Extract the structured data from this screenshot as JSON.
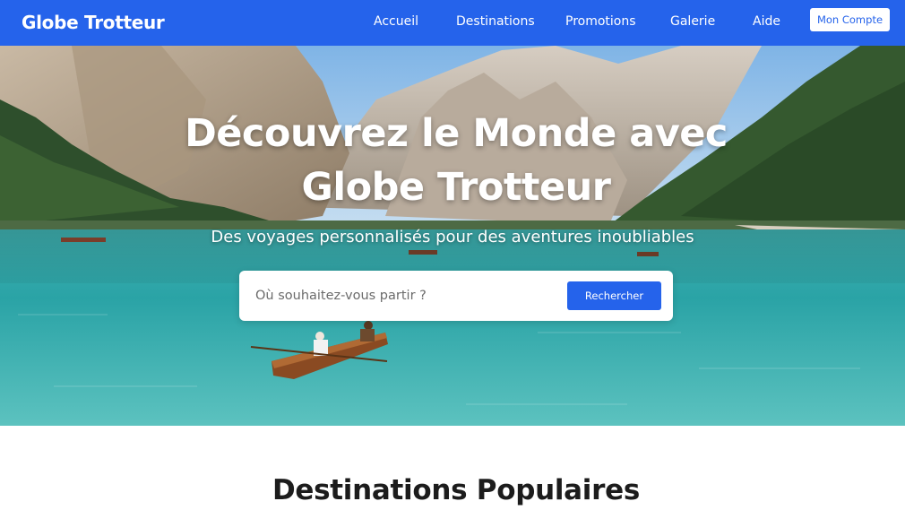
{
  "header": {
    "logo": "Globe Trotteur",
    "nav": [
      "Accueil",
      "Destinations",
      "Promotions",
      "Galerie",
      "Aide"
    ],
    "account_button": "Mon Compte",
    "bg_color": "#2563eb"
  },
  "hero": {
    "title_line1": "Découvrez le Monde avec",
    "title_line2": "Globe Trotteur",
    "subtitle": "Des voyages personnalisés pour des aventures inoubliables",
    "search": {
      "placeholder": "Où souhaitez-vous partir ?",
      "button_label": "Rechercher"
    }
  },
  "sections": {
    "popular_title": "Destinations Populaires"
  }
}
